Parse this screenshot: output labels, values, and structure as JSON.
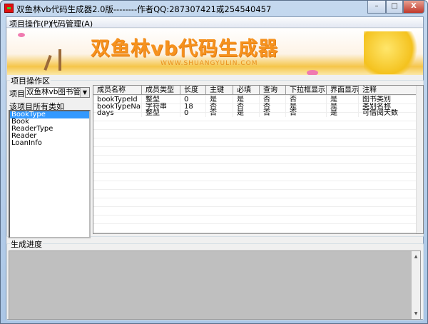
{
  "window": {
    "title": "双鱼林vb代码生成器2.0版--------作者QQ:287307421或254540457",
    "min": "–",
    "max": "□",
    "close": "X"
  },
  "menu": [
    "项目操作(P)",
    "代码管理(A)"
  ],
  "banner": {
    "title": "双鱼林vb代码生成器",
    "url": "WWW.SHUANGYULIN.COM"
  },
  "project_area": {
    "label": "项目操作区",
    "project_label": "项目",
    "project_value": "双鱼林vb图书管理",
    "classes_label": "该项目所有类如",
    "classes": [
      "BookType",
      "Book",
      "ReaderType",
      "Reader",
      "LoanInfo"
    ],
    "selected": "BookType"
  },
  "grid": {
    "columns": [
      "成员名称",
      "成员类型",
      "长度",
      "主键",
      "必填",
      "查询",
      "下拉框显示",
      "界面显示",
      "注释"
    ],
    "rows": [
      [
        "bookTypeId",
        "整型",
        "0",
        "是",
        "是",
        "否",
        "否",
        "是",
        "图书类别"
      ],
      [
        "bookTypeName",
        "字符串",
        "18",
        "否",
        "否",
        "否",
        "是",
        "是",
        "类别名称"
      ],
      [
        "days",
        "整型",
        "0",
        "否",
        "是",
        "否",
        "否",
        "是",
        "可借阅天数"
      ]
    ]
  },
  "progress": {
    "label": "生成进度"
  }
}
